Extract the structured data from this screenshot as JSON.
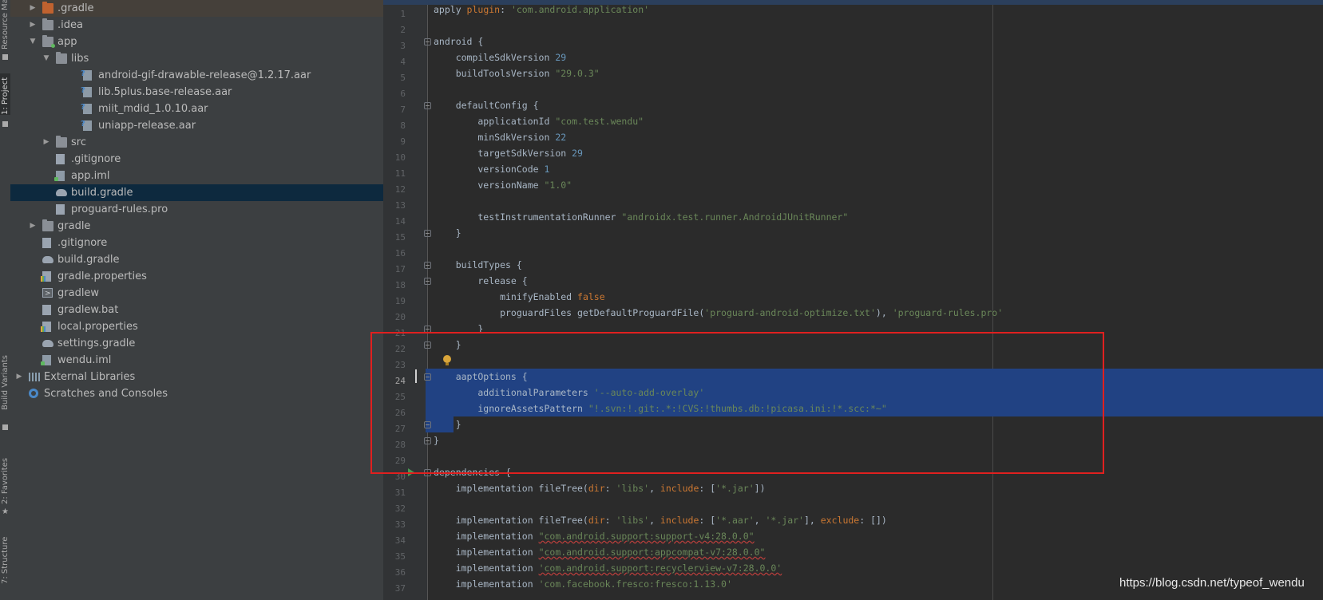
{
  "tool_window_tabs": [
    "Resource Manager",
    "1: Project",
    "Build Variants",
    "2: Favorites",
    "7: Structure"
  ],
  "project_tree": [
    {
      "label": ".gradle",
      "icon": "folder-orange-icon",
      "expandable": true,
      "expanded": false
    },
    {
      "label": ".idea",
      "icon": "folder-icon",
      "expandable": true,
      "expanded": false
    },
    {
      "label": "app",
      "icon": "module-folder-icon",
      "expandable": true,
      "expanded": true
    },
    {
      "label": "libs",
      "icon": "folder-icon",
      "expandable": true,
      "expanded": true
    },
    {
      "label": "android-gif-drawable-release@1.2.17.aar",
      "icon": "aar-file-icon",
      "expandable": false
    },
    {
      "label": "lib.5plus.base-release.aar",
      "icon": "aar-file-icon",
      "expandable": false
    },
    {
      "label": "miit_mdid_1.0.10.aar",
      "icon": "aar-file-icon",
      "expandable": false
    },
    {
      "label": "uniapp-release.aar",
      "icon": "aar-file-icon",
      "expandable": false
    },
    {
      "label": "src",
      "icon": "folder-icon",
      "expandable": true,
      "expanded": false
    },
    {
      "label": ".gitignore",
      "icon": "text-file-icon",
      "expandable": false
    },
    {
      "label": "app.iml",
      "icon": "iml-file-icon",
      "expandable": false
    },
    {
      "label": "build.gradle",
      "icon": "gradle-file-icon",
      "expandable": false,
      "selected": true
    },
    {
      "label": "proguard-rules.pro",
      "icon": "text-file-icon",
      "expandable": false
    },
    {
      "label": "gradle",
      "icon": "folder-icon",
      "expandable": true,
      "expanded": false
    },
    {
      "label": ".gitignore",
      "icon": "text-file-icon",
      "expandable": false
    },
    {
      "label": "build.gradle",
      "icon": "gradle-file-icon",
      "expandable": false
    },
    {
      "label": "gradle.properties",
      "icon": "properties-file-icon",
      "expandable": false
    },
    {
      "label": "gradlew",
      "icon": "executable-file-icon",
      "expandable": false
    },
    {
      "label": "gradlew.bat",
      "icon": "text-file-icon",
      "expandable": false
    },
    {
      "label": "local.properties",
      "icon": "properties-file-icon",
      "expandable": false
    },
    {
      "label": "settings.gradle",
      "icon": "gradle-file-icon",
      "expandable": false
    },
    {
      "label": "wendu.iml",
      "icon": "iml-file-icon",
      "expandable": false
    },
    {
      "label": "External Libraries",
      "icon": "library-icon",
      "expandable": true,
      "expanded": false
    },
    {
      "label": "Scratches and Consoles",
      "icon": "scratches-icon",
      "expandable": false
    }
  ],
  "editor": {
    "current_line": 24,
    "lines": [
      {
        "n": "1",
        "tokens": [
          [
            "t",
            "apply "
          ],
          [
            "kw",
            "plugin"
          ],
          [
            "t",
            ": "
          ],
          [
            "str",
            "'com.android.application'"
          ]
        ]
      },
      {
        "n": "2",
        "tokens": []
      },
      {
        "n": "3",
        "tokens": [
          [
            "t",
            "android {"
          ]
        ]
      },
      {
        "n": "4",
        "tokens": [
          [
            "t",
            "    compileSdkVersion "
          ],
          [
            "num",
            "29"
          ]
        ]
      },
      {
        "n": "5",
        "tokens": [
          [
            "t",
            "    buildToolsVersion "
          ],
          [
            "str",
            "\"29.0.3\""
          ]
        ]
      },
      {
        "n": "6",
        "tokens": []
      },
      {
        "n": "7",
        "tokens": [
          [
            "t",
            "    defaultConfig {"
          ]
        ]
      },
      {
        "n": "8",
        "tokens": [
          [
            "t",
            "        applicationId "
          ],
          [
            "str",
            "\"com.test.wendu\""
          ]
        ]
      },
      {
        "n": "9",
        "tokens": [
          [
            "t",
            "        minSdkVersion "
          ],
          [
            "num",
            "22"
          ]
        ]
      },
      {
        "n": "10",
        "tokens": [
          [
            "t",
            "        targetSdkVersion "
          ],
          [
            "num",
            "29"
          ]
        ]
      },
      {
        "n": "11",
        "tokens": [
          [
            "t",
            "        versionCode "
          ],
          [
            "num",
            "1"
          ]
        ]
      },
      {
        "n": "12",
        "tokens": [
          [
            "t",
            "        versionName "
          ],
          [
            "str",
            "\"1.0\""
          ]
        ]
      },
      {
        "n": "13",
        "tokens": []
      },
      {
        "n": "14",
        "tokens": [
          [
            "t",
            "        testInstrumentationRunner "
          ],
          [
            "str",
            "\"androidx.test.runner.AndroidJUnitRunner\""
          ]
        ]
      },
      {
        "n": "15",
        "tokens": [
          [
            "t",
            "    }"
          ]
        ]
      },
      {
        "n": "16",
        "tokens": []
      },
      {
        "n": "17",
        "tokens": [
          [
            "t",
            "    buildTypes {"
          ]
        ]
      },
      {
        "n": "18",
        "tokens": [
          [
            "t",
            "        release {"
          ]
        ]
      },
      {
        "n": "19",
        "tokens": [
          [
            "t",
            "            minifyEnabled "
          ],
          [
            "kw",
            "false"
          ]
        ]
      },
      {
        "n": "20",
        "tokens": [
          [
            "t",
            "            proguardFiles getDefaultProguardFile("
          ],
          [
            "str",
            "'proguard-android-optimize.txt'"
          ],
          [
            "t",
            "), "
          ],
          [
            "str",
            "'proguard-rules.pro'"
          ]
        ]
      },
      {
        "n": "21",
        "tokens": [
          [
            "t",
            "        }"
          ]
        ]
      },
      {
        "n": "22",
        "tokens": [
          [
            "t",
            "    }"
          ]
        ]
      },
      {
        "n": "23",
        "tokens": []
      },
      {
        "n": "24",
        "tokens": [
          [
            "t",
            "    aaptOptions {"
          ]
        ]
      },
      {
        "n": "25",
        "tokens": [
          [
            "t",
            "        additionalParameters "
          ],
          [
            "str",
            "'--auto-add-overlay'"
          ]
        ]
      },
      {
        "n": "26",
        "tokens": [
          [
            "t",
            "        ignoreAssetsPattern "
          ],
          [
            "str",
            "\"!.svn:!.git:.*:!CVS:!thumbs.db:!picasa.ini:!*.scc:*~\""
          ]
        ]
      },
      {
        "n": "27",
        "tokens": [
          [
            "t",
            "    }"
          ]
        ]
      },
      {
        "n": "28",
        "tokens": [
          [
            "t",
            "}"
          ]
        ]
      },
      {
        "n": "29",
        "tokens": []
      },
      {
        "n": "30",
        "tokens": [
          [
            "t",
            "dependencies {"
          ]
        ]
      },
      {
        "n": "31",
        "tokens": [
          [
            "t",
            "    implementation fileTree("
          ],
          [
            "kw",
            "dir"
          ],
          [
            "t",
            ": "
          ],
          [
            "str",
            "'libs'"
          ],
          [
            "t",
            ", "
          ],
          [
            "kw",
            "include"
          ],
          [
            "t",
            ": ["
          ],
          [
            "str",
            "'*.jar'"
          ],
          [
            "t",
            "])"
          ]
        ]
      },
      {
        "n": "32",
        "tokens": []
      },
      {
        "n": "33",
        "tokens": [
          [
            "t",
            "    implementation fileTree("
          ],
          [
            "kw",
            "dir"
          ],
          [
            "t",
            ": "
          ],
          [
            "str",
            "'libs'"
          ],
          [
            "t",
            ", "
          ],
          [
            "kw",
            "include"
          ],
          [
            "t",
            ": ["
          ],
          [
            "str",
            "'*.aar'"
          ],
          [
            "t",
            ", "
          ],
          [
            "str",
            "'*.jar'"
          ],
          [
            "t",
            "], "
          ],
          [
            "kw",
            "exclude"
          ],
          [
            "t",
            ": [])"
          ]
        ]
      },
      {
        "n": "34",
        "tokens": [
          [
            "t",
            "    implementation "
          ],
          [
            "squig",
            "\"com.android.support:support-v4:28.0.0\""
          ]
        ]
      },
      {
        "n": "35",
        "tokens": [
          [
            "t",
            "    implementation "
          ],
          [
            "squig",
            "\"com.android.support:appcompat-v7:28.0.0\""
          ]
        ]
      },
      {
        "n": "36",
        "tokens": [
          [
            "t",
            "    implementation "
          ],
          [
            "squig",
            "'com.android.support:recyclerview-v7:28.0.0'"
          ]
        ]
      },
      {
        "n": "37",
        "tokens": [
          [
            "t",
            "    implementation "
          ],
          [
            "str",
            "'com.facebook.fresco:fresco:1.13.0'"
          ]
        ]
      }
    ]
  },
  "watermark": "https://blog.csdn.net/typeof_wendu",
  "colors": {
    "selection": "#214283",
    "highlight_box": "#e0201f",
    "tree_selected": "#0d293e"
  }
}
